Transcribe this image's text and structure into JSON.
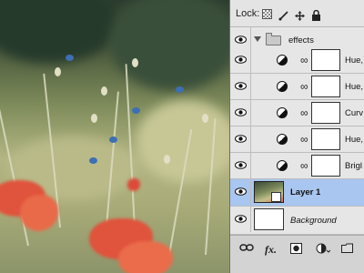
{
  "lock_bar": {
    "label": "Lock:"
  },
  "layers": [
    {
      "name": "effects",
      "kind": "group"
    },
    {
      "name": "Hue,",
      "kind": "adjustment"
    },
    {
      "name": "Hue,",
      "kind": "adjustment"
    },
    {
      "name": "Curv",
      "kind": "adjustment"
    },
    {
      "name": "Hue,",
      "kind": "adjustment"
    },
    {
      "name": "Brigl",
      "kind": "adjustment"
    },
    {
      "name": "Layer 1",
      "kind": "pixel",
      "selected": true
    },
    {
      "name": "Background",
      "kind": "background"
    }
  ],
  "bottom_bar": {
    "fx_label": "fx."
  },
  "icons": {
    "eye": "eye-icon",
    "chain": "chain-link-icon",
    "adjustment": "adjustment-circle-icon",
    "folder": "folder-icon",
    "lock_transparent": "lock-transparent-icon",
    "lock_brush": "brush-icon",
    "lock_move": "move-icon",
    "lock_all": "padlock-icon"
  },
  "colors": {
    "selected_row": "#a8c6ef",
    "panel_bg": "#d6d6d6"
  }
}
